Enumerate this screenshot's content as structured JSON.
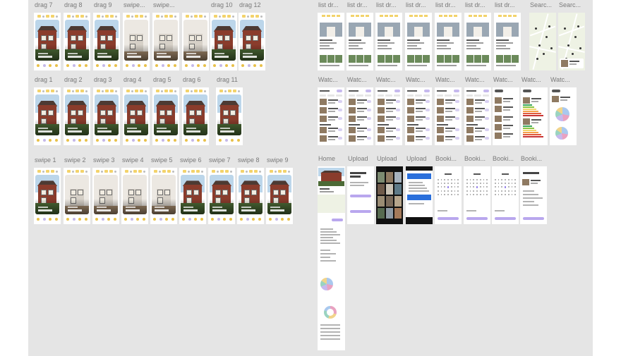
{
  "canvas_bg": "#e5e5e5",
  "accent": "#f3d36b",
  "primary": "#b9a7ee",
  "frames": {
    "drag7": "drag 7",
    "drag8": "drag 8",
    "drag9": "drag 9",
    "swipeA": "swipe...",
    "swipeB": "swipe...",
    "drag10": "drag 10",
    "drag12": "drag 12",
    "drag1": "drag 1",
    "drag2": "drag 2",
    "drag3": "drag 3",
    "drag4": "drag 4",
    "drag5": "drag 5",
    "drag6": "drag 6",
    "drag11": "drag 11",
    "swipe1": "swipe 1",
    "swipe2": "swipe 2",
    "swipe3": "swipe 3",
    "swipe4": "swipe 4",
    "swipe5": "swipe 5",
    "swipe6": "swipe 6",
    "swipe7": "swipe 7",
    "swipe8": "swipe 8",
    "swipe9": "swipe 9",
    "list1": "list dr...",
    "list2": "list dr...",
    "list3": "list dr...",
    "list4": "list dr...",
    "list5": "list dr...",
    "list6": "list dr...",
    "list7": "list dr...",
    "search1": "Searc...",
    "search2": "Searc...",
    "watch1": "Watc...",
    "watch2": "Watc...",
    "watch3": "Watc...",
    "watch4": "Watc...",
    "watch5": "Watc...",
    "watch6": "Watc...",
    "watch7": "Watc...",
    "watch8": "Watc...",
    "watch9": "Watc...",
    "home": "Home",
    "upload1": "Upload",
    "upload2": "Upload",
    "upload3": "Upload",
    "booking1": "Booki...",
    "booking2": "Booki...",
    "booking3": "Booki...",
    "booking4": "Booki..."
  }
}
